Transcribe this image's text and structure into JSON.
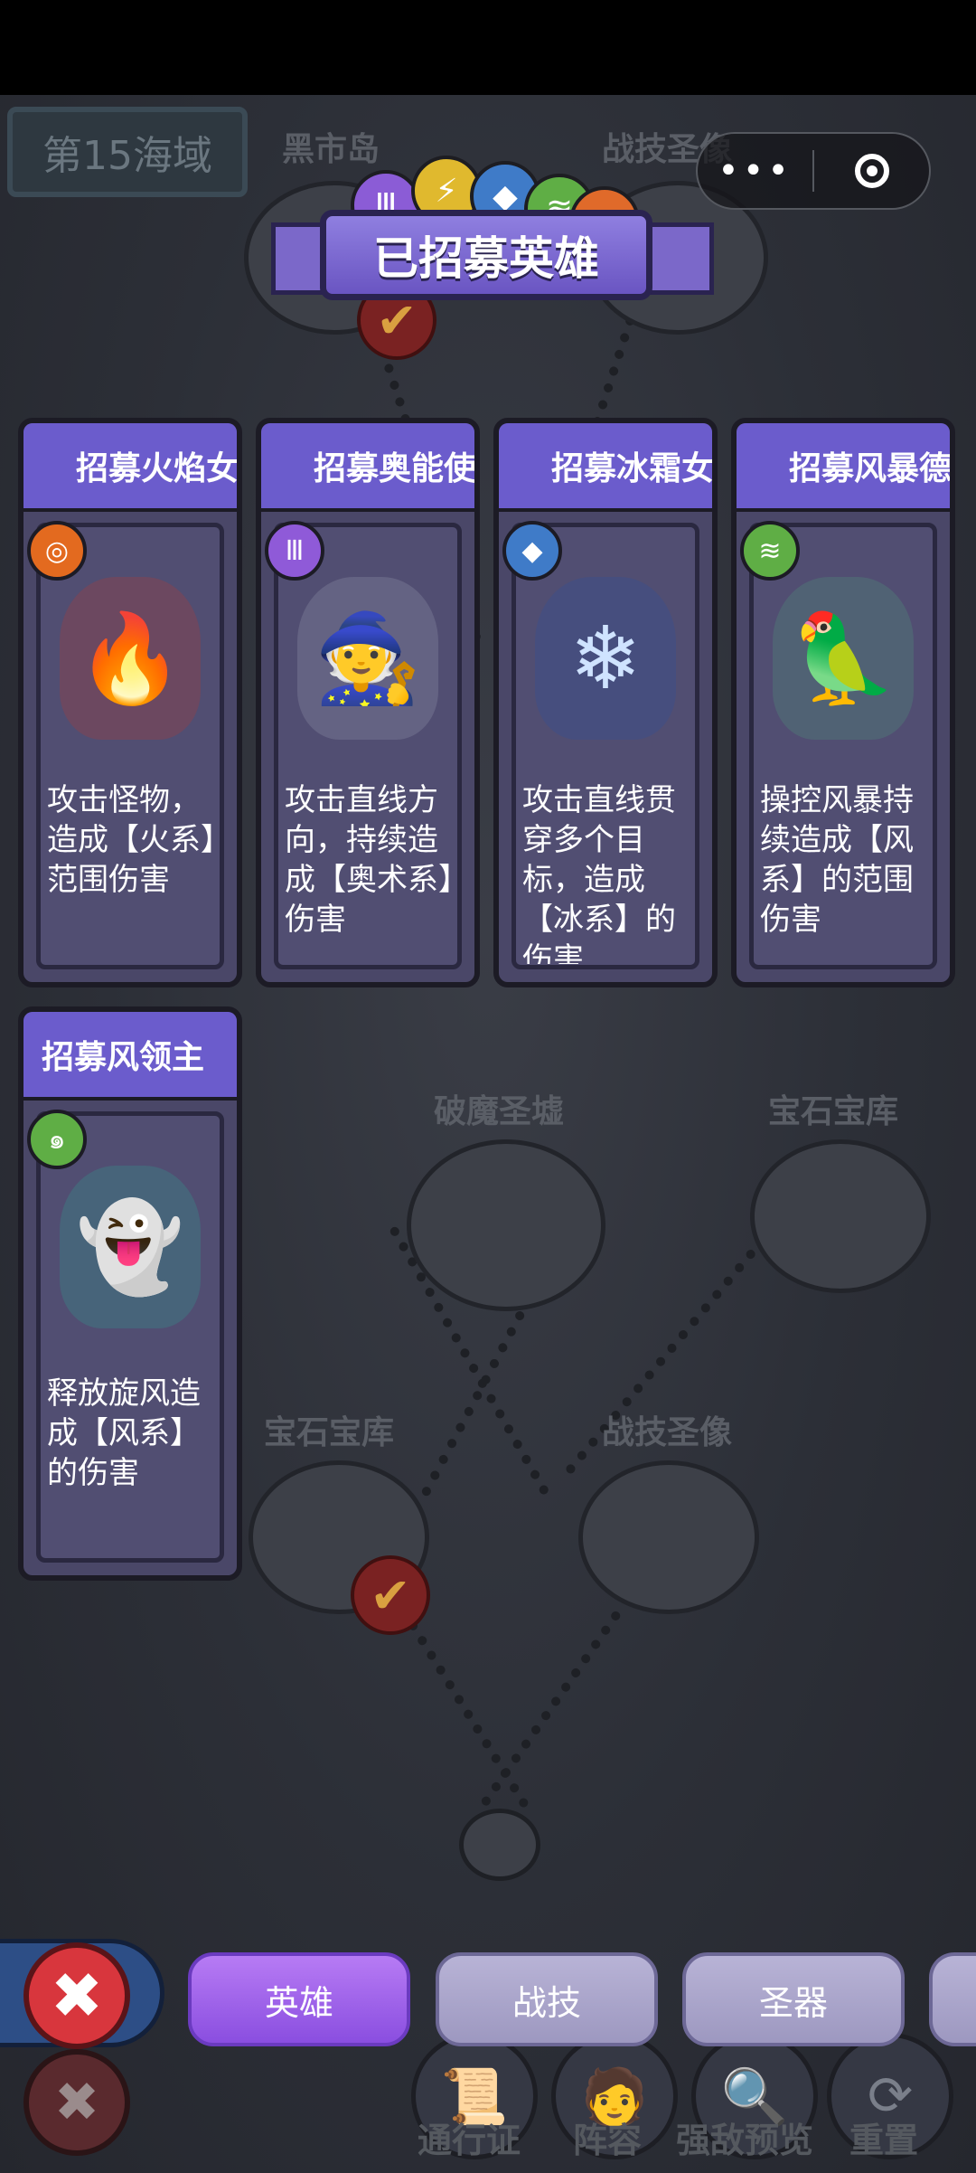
{
  "map": {
    "sea_label": "第15海域",
    "nodes": [
      {
        "name": "黑市岛"
      },
      {
        "name": "战技圣像"
      },
      {
        "name": "破魔圣墟"
      },
      {
        "name": "宝石宝库"
      },
      {
        "name": "宝石宝库"
      },
      {
        "name": "战技圣像"
      }
    ]
  },
  "capsule": {
    "more_glyph": "•••",
    "target_glyph": ""
  },
  "panel_title": "已招募英雄",
  "element_orbs": [
    {
      "icon": "arcane-icon",
      "glyph": "Ⅲ",
      "color": "#8b5cd6"
    },
    {
      "icon": "lightning-icon",
      "glyph": "⚡",
      "color": "#e0b92e"
    },
    {
      "icon": "ice-icon",
      "glyph": "◆",
      "color": "#3f7bc8"
    },
    {
      "icon": "wind-icon",
      "glyph": "≋",
      "color": "#5fae45"
    },
    {
      "icon": "fire-icon",
      "glyph": "◎",
      "color": "#e06a2a"
    }
  ],
  "heroes": [
    {
      "title": "招募火焰女",
      "desc": "攻击怪物，造成【火系】范围伤害",
      "element_icon": "fire-icon",
      "element_glyph": "◎",
      "element_color": "#e36a1f",
      "portrait_glyph": "🔥",
      "portrait_color": "#c0392b"
    },
    {
      "title": "招募奥能使",
      "desc": "攻击直线方向，持续造成【奥术系】伤害",
      "element_icon": "arcane-icon",
      "element_glyph": "Ⅲ",
      "element_color": "#8f5ad8",
      "portrait_glyph": "🧙",
      "portrait_color": "#d8dce6"
    },
    {
      "title": "招募冰霜女",
      "desc": "攻击直线贯穿多个目标，造成【冰系】的伤害",
      "element_icon": "ice-icon",
      "element_glyph": "◆",
      "element_color": "#3f7bc8",
      "portrait_glyph": "❄",
      "portrait_color": "#2f4f9c"
    },
    {
      "title": "招募风暴德",
      "desc": "操控风暴持续造成【风系】的范围伤害",
      "element_icon": "wind-icon",
      "element_glyph": "≋",
      "element_color": "#5fae45",
      "portrait_glyph": "🦜",
      "portrait_color": "#4e9e7a"
    },
    {
      "title": "招募风领主",
      "desc": "释放旋风造成【风系】的伤害",
      "element_icon": "whirlwind-icon",
      "element_glyph": "๑",
      "element_color": "#5fae45",
      "portrait_glyph": "👻",
      "portrait_color": "#2aa894"
    }
  ],
  "tabs": [
    {
      "label": "英雄",
      "active": true
    },
    {
      "label": "战技",
      "active": false
    },
    {
      "label": "圣器",
      "active": false
    }
  ],
  "bottom_menu": [
    {
      "label": "通行证"
    },
    {
      "label": "阵容"
    },
    {
      "label": "强敌预览"
    },
    {
      "label": "重置"
    }
  ],
  "close_glyph": "✖"
}
